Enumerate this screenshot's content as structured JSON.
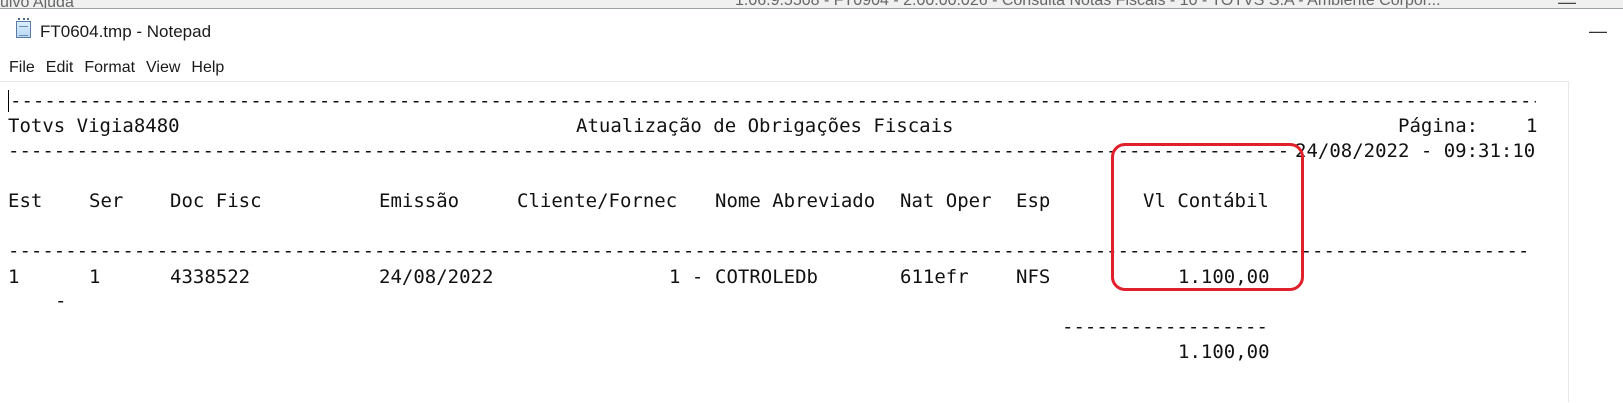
{
  "background": {
    "left_text": "uivo   Ajuda",
    "right_text": "1.06.9.5508 - FT0904 - 2.00.00.026 - Consulta Notas Fiscais - 10 - TOTVS S.A - Ambiente Corpor...",
    "minimize_glyph": "—"
  },
  "window": {
    "title": "FT0604.tmp - Notepad",
    "app_icon": "notepad-icon",
    "minimize_glyph": "—"
  },
  "menu": [
    {
      "label": "File"
    },
    {
      "label": "Edit"
    },
    {
      "label": "Format"
    },
    {
      "label": "View"
    },
    {
      "label": "Help"
    }
  ],
  "report": {
    "separator_top": "-------------------------------------------------------------------------------------------------------------------------------------------------------------------",
    "company": "Totvs Vigia8480",
    "title": "Atualização de Obrigações Fiscais",
    "page_label": "Página:",
    "page_number": "1",
    "separator_date": "---------------------------------------------------------------------------------------------------------------------------------",
    "datetime": "24/08/2022 - 09:31:10",
    "columns": [
      "Est",
      "Ser",
      "Doc Fisc",
      "Emissão",
      "Cliente/Fornec",
      "Nome Abreviado",
      "Nat Oper",
      "Esp",
      "Vl Contábil"
    ],
    "separator_header": "-----------------------------------------------------------------------------------------------------------------------------------------------------------------",
    "row": {
      "est": "1",
      "ser": "1",
      "doc": "4338522",
      "emissao": "24/08/2022",
      "cliente": "1 -",
      "nome": "COTROLEDb",
      "nat": "611efr",
      "esp": "NFS",
      "valor": "1.100,00"
    },
    "row_cont": "-",
    "total_separator": "------------------",
    "total": "1.100,00"
  },
  "highlight_color": "#e0202a"
}
